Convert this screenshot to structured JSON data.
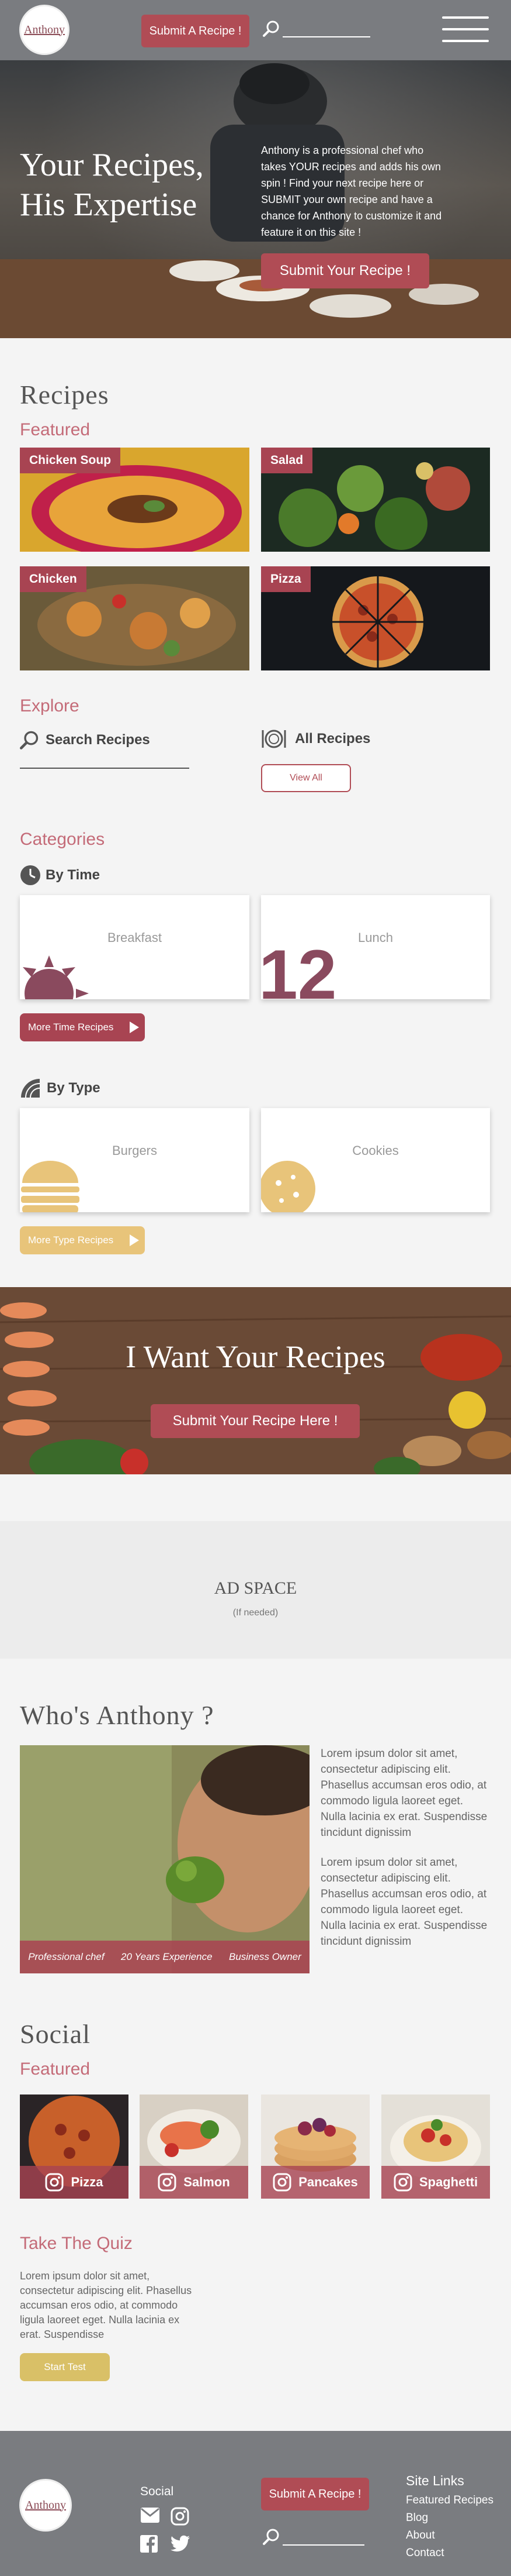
{
  "header": {
    "logo_text": "Anthony",
    "submit_label": "Submit A Recipe !",
    "icons": [
      "search-icon",
      "menu-icon"
    ]
  },
  "hero": {
    "title_line1": "Your Recipes,",
    "title_line2": "His Expertise",
    "text": "Anthony is a professional chef who takes YOUR recipes and adds his own spin ! Find your next recipe here or SUBMIT your own recipe and have a chance for Anthony to customize it and feature it on this site !",
    "button_label": "Submit Your Recipe !"
  },
  "recipes": {
    "heading": "Recipes",
    "featured_heading": "Featured",
    "cards": [
      {
        "label": "Chicken Soup"
      },
      {
        "label": "Salad"
      },
      {
        "label": "Chicken"
      },
      {
        "label": "Pizza"
      }
    ]
  },
  "explore": {
    "heading": "Explore",
    "search_label": "Search Recipes",
    "all_label": "All Recipes",
    "view_all": "View All"
  },
  "categories": {
    "heading": "Categories",
    "by_time": "By Time",
    "time_cards": [
      {
        "label": "Breakfast"
      },
      {
        "label": "Lunch",
        "numeral": "12"
      }
    ],
    "more_time": "More Time Recipes",
    "by_type": "By Type",
    "type_cards": [
      {
        "label": "Burgers"
      },
      {
        "label": "Cookies"
      }
    ],
    "more_type": "More Type Recipes"
  },
  "banner": {
    "title": "I Want Your Recipes",
    "button_label": "Submit Your Recipe Here !"
  },
  "ad": {
    "title": "AD SPACE",
    "note": "(If needed)"
  },
  "who": {
    "heading": "Who's Anthony ?",
    "tags": [
      "Professional chef",
      "20 Years Experience",
      "Business Owner"
    ],
    "para1": "Lorem ipsum dolor sit amet, consectetur adipiscing elit. Phasellus accumsan eros odio, at commodo ligula laoreet eget. Nulla lacinia ex erat. Suspendisse tincidunt dignissim",
    "para2": "Lorem ipsum dolor sit amet, consectetur adipiscing elit. Phasellus accumsan eros odio, at commodo ligula laoreet eget. Nulla lacinia ex erat. Suspendisse tincidunt dignissim"
  },
  "social": {
    "heading": "Social",
    "featured_heading": "Featured",
    "cards": [
      {
        "label": "Pizza"
      },
      {
        "label": "Salmon"
      },
      {
        "label": "Pancakes"
      },
      {
        "label": "Spaghetti"
      }
    ]
  },
  "quiz": {
    "heading": "Take The Quiz",
    "text": "Lorem ipsum dolor sit amet, consectetur adipiscing elit. Phasellus accumsan eros odio, at commodo ligula laoreet eget. Nulla lacinia ex erat. Suspendisse",
    "button_label": "Start Test"
  },
  "footer": {
    "logo_text": "Anthony",
    "social_label": "Social",
    "submit_label": "Submit A Recipe !",
    "links_heading": "Site Links",
    "links": [
      "Featured Recipes",
      "Blog",
      "About",
      "Contact"
    ]
  },
  "colors": {
    "accent": "#b04c55",
    "header_grey": "#7a7c80",
    "gold": "#d9c067",
    "pink_heading": "#c46b78"
  }
}
